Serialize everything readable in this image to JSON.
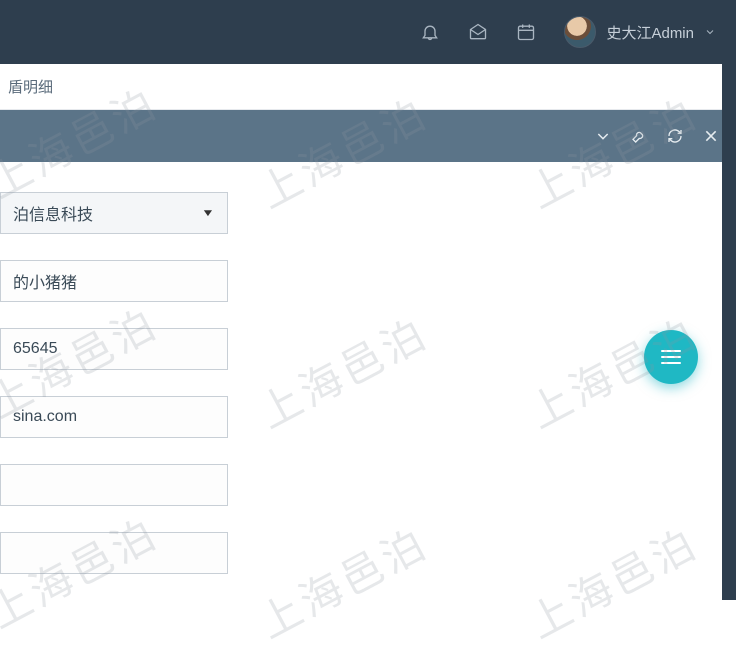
{
  "header": {
    "user_name": "史大江Admin"
  },
  "breadcrumb": {
    "tail": "盾明细"
  },
  "form": {
    "company_select": "泊信息科技",
    "field2": "的小猪猪",
    "field3": "65645",
    "field4": "sina.com",
    "field5": "",
    "field6": ""
  },
  "watermark_text": "上海邑泊",
  "colors": {
    "topbar": "#2e3e4e",
    "panel_header": "#5b7488",
    "fab": "#1fb8c4"
  }
}
